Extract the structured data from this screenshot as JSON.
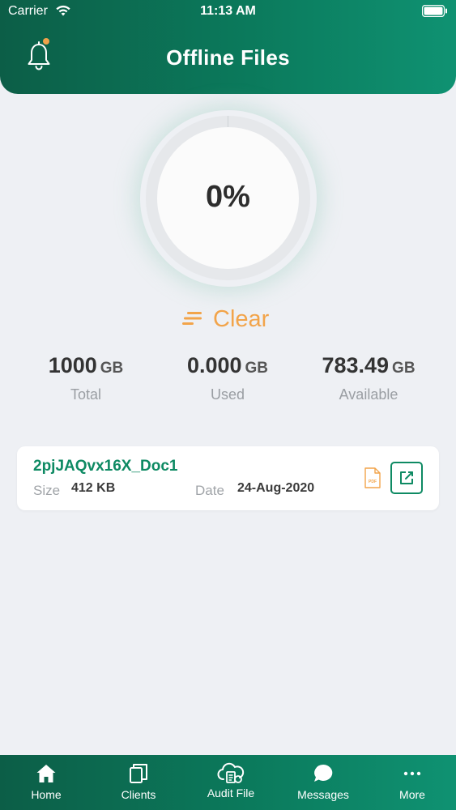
{
  "status_bar": {
    "carrier": "Carrier",
    "time": "11:13 AM"
  },
  "header": {
    "title": "Offline Files",
    "notification_icon": "bell-icon",
    "notification_dot_color": "#f0a24a"
  },
  "storage": {
    "percent_label": "0%",
    "percent_value": 0,
    "clear_label": "Clear",
    "total": {
      "value": "1000",
      "unit": "GB",
      "caption": "Total"
    },
    "used": {
      "value": "0.000",
      "unit": "GB",
      "caption": "Used"
    },
    "available": {
      "value": "783.49",
      "unit": "GB",
      "caption": "Available"
    }
  },
  "files": [
    {
      "name": "2pjJAQvx16X_Doc1",
      "size_caption": "Size",
      "size": "412 KB",
      "date_caption": "Date",
      "date": "24-Aug-2020",
      "type_icon": "pdf-icon",
      "action_icon": "open-external-icon"
    }
  ],
  "tabs": [
    {
      "label": "Home",
      "icon": "home-icon"
    },
    {
      "label": "Clients",
      "icon": "clients-icon"
    },
    {
      "label": "Audit File",
      "icon": "audit-file-icon"
    },
    {
      "label": "Messages",
      "icon": "messages-icon"
    },
    {
      "label": "More",
      "icon": "more-icon"
    }
  ],
  "colors": {
    "primary": "#0b7a5c",
    "accent": "#f2a44a",
    "background": "#eef0f4"
  }
}
